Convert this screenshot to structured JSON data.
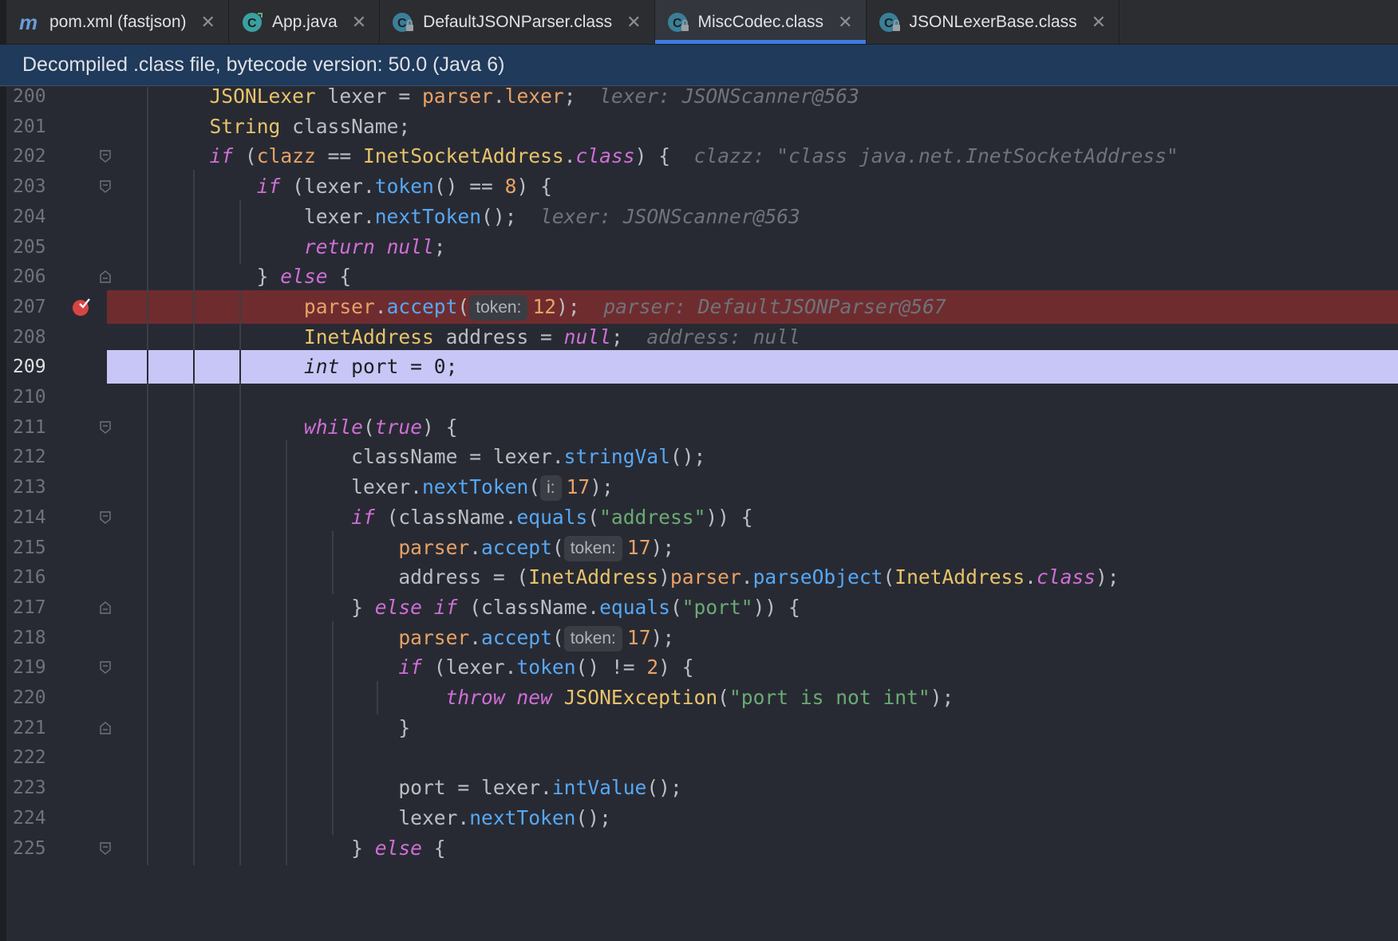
{
  "tabs": [
    {
      "label": "pom.xml (fastjson)",
      "icon": "maven-icon",
      "active": false
    },
    {
      "label": "App.java",
      "icon": "java-class-icon",
      "active": false
    },
    {
      "label": "DefaultJSONParser.class",
      "icon": "compiled-class-icon",
      "active": false
    },
    {
      "label": "MiscCodec.class",
      "icon": "compiled-class-icon",
      "active": true
    },
    {
      "label": "JSONLexerBase.class",
      "icon": "compiled-class-icon",
      "active": false
    }
  ],
  "banner": "Decompiled .class file, bytecode version: 50.0 (Java 6)",
  "lines": [
    {
      "num": "200",
      "html": "        <span class='ty'>JSONLexer</span> lexer = <span class='fld'>parser</span>.<span class='fld'>lexer</span>;  <span class='hint'>lexer: JSONScanner@563</span>"
    },
    {
      "num": "201",
      "html": "        <span class='ty'>String</span> className;"
    },
    {
      "num": "202",
      "html": "        <span class='kw'>if</span> (<span class='fld'>clazz</span> == <span class='ty'>InetSocketAddress</span>.<span class='kw'>class</span>) {  <span class='hint'>clazz: \"class java.net.InetSocketAddress\"</span>"
    },
    {
      "num": "203",
      "html": "            <span class='kw'>if</span> (lexer.<span class='fn'>token</span>() == <span class='nu'>8</span>) {"
    },
    {
      "num": "204",
      "html": "                lexer.<span class='fn'>nextToken</span>();  <span class='hint'>lexer: JSONScanner@563</span>"
    },
    {
      "num": "205",
      "html": "                <span class='kw'>return null</span>;"
    },
    {
      "num": "206",
      "html": "            } <span class='kw'>else</span> {"
    },
    {
      "num": "207",
      "html": "                <span class='fld'>parser</span>.<span class='fn'>accept</span>(<span class='phint'>token:</span><span class='nu'>12</span>);  <span class='hint'>parser: DefaultJSONParser@567</span>"
    },
    {
      "num": "208",
      "html": "                <span class='ty'>InetAddress</span> address = <span class='kw'>null</span>;  <span class='hint'>address: null</span>"
    },
    {
      "num": "209",
      "html": "                <span class='kw'>int</span> port = 0;"
    },
    {
      "num": "210",
      "html": ""
    },
    {
      "num": "211",
      "html": "                <span class='kw'>while</span>(<span class='kw'>true</span>) {"
    },
    {
      "num": "212",
      "html": "                    className = lexer.<span class='fn'>stringVal</span>();"
    },
    {
      "num": "213",
      "html": "                    lexer.<span class='fn'>nextToken</span>(<span class='phint'>i:</span><span class='nu'>17</span>);"
    },
    {
      "num": "214",
      "html": "                    <span class='kw'>if</span> (className.<span class='fn'>equals</span>(<span class='st'>\"address\"</span>)) {"
    },
    {
      "num": "215",
      "html": "                        <span class='fld'>parser</span>.<span class='fn'>accept</span>(<span class='phint'>token:</span><span class='nu'>17</span>);"
    },
    {
      "num": "216",
      "html": "                        address = (<span class='ty'>InetAddress</span>)<span class='fld'>parser</span>.<span class='fn'>parseObject</span>(<span class='ty'>InetAddress</span>.<span class='kw'>class</span>);"
    },
    {
      "num": "217",
      "html": "                    } <span class='kw'>else if</span> (className.<span class='fn'>equals</span>(<span class='st'>\"port\"</span>)) {"
    },
    {
      "num": "218",
      "html": "                        <span class='fld'>parser</span>.<span class='fn'>accept</span>(<span class='phint'>token:</span><span class='nu'>17</span>);"
    },
    {
      "num": "219",
      "html": "                        <span class='kw'>if</span> (lexer.<span class='fn'>token</span>() != <span class='nu'>2</span>) {"
    },
    {
      "num": "220",
      "html": "                            <span class='kw'>throw new</span> <span class='ty'>JSONException</span>(<span class='st'>\"port is not int\"</span>);"
    },
    {
      "num": "221",
      "html": "                        }"
    },
    {
      "num": "222",
      "html": ""
    },
    {
      "num": "223",
      "html": "                        port = lexer.<span class='fn'>intValue</span>();"
    },
    {
      "num": "224",
      "html": "                        lexer.<span class='fn'>nextToken</span>();"
    },
    {
      "num": "225",
      "html": "                    } <span class='kw'>else</span> {"
    }
  ]
}
